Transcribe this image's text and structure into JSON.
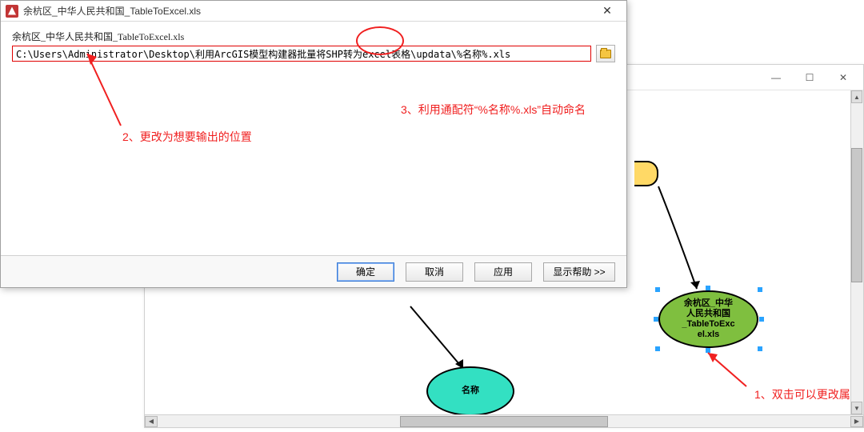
{
  "dialog": {
    "title": "余杭区_中华人民共和国_TableToExcel.xls",
    "field_label": "余杭区_中华人民共和国_TableToExcel.xls",
    "path_value": "C:\\Users\\Administrator\\Desktop\\利用ArcGIS模型构建器批量将SHP转为excel表格\\updata\\%名称%.xls",
    "buttons": {
      "ok": "确定",
      "cancel": "取消",
      "apply": "应用",
      "help": "显示帮助 >>"
    }
  },
  "annotations": {
    "note1": "1、双击可以更改属",
    "note2": "2、更改为想要输出的位置",
    "note3": "3、利用通配符“%名称%.xls”自动命名"
  },
  "model": {
    "node_cyan": "名称",
    "node_green": "余杭区_中华\n人民共和国\n_TableToExc\nel.xls"
  },
  "backwin": {
    "min": "—",
    "max": "☐",
    "close": "✕"
  }
}
